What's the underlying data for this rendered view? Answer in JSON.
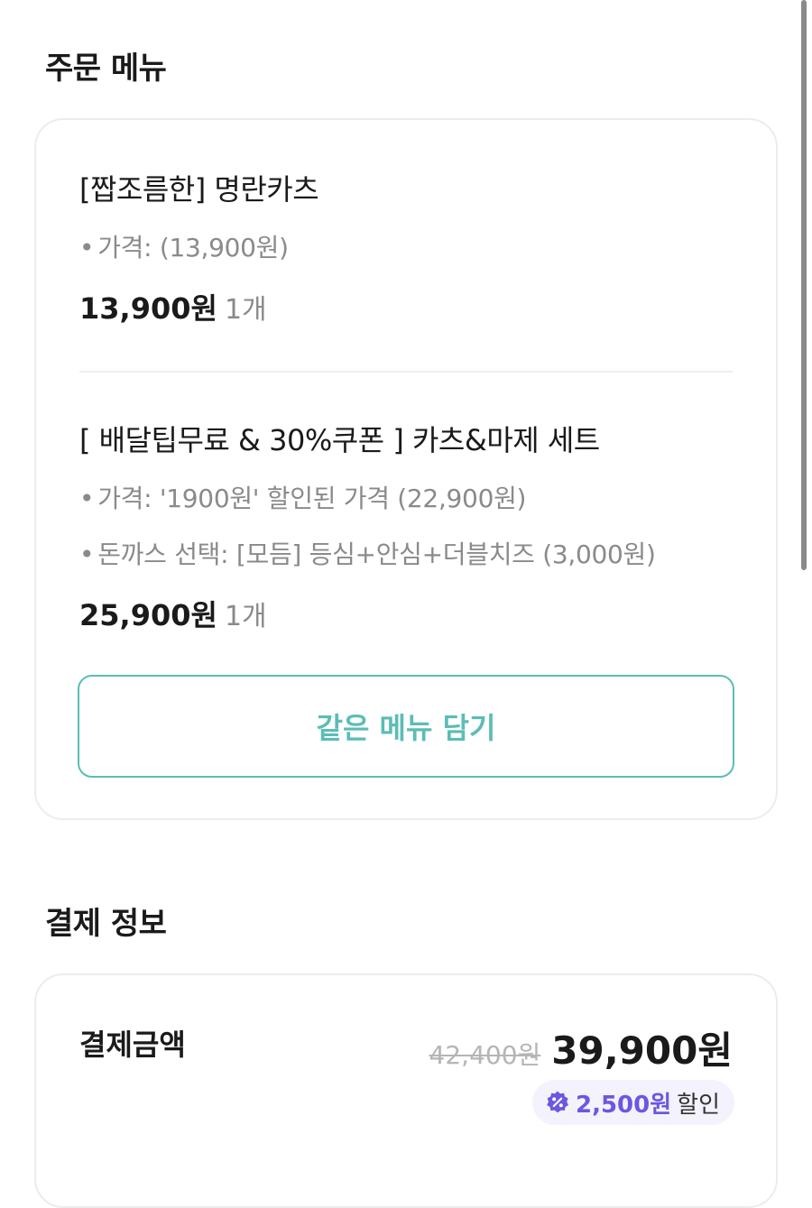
{
  "order_section": {
    "title": "주문 메뉴",
    "items": [
      {
        "name": "[짭조름한] 명란카츠",
        "options": [
          "가격: (13,900원)"
        ],
        "price": "13,900원",
        "quantity": "1개"
      },
      {
        "name": "[ 배달팁무료 & 30%쿠폰 ] 카츠&마제 세트",
        "options": [
          "가격: '1900원' 할인된 가격 (22,900원)",
          "돈까스 선택: [모듬] 등심+안심+더블치즈 (3,000원)"
        ],
        "price": "25,900원",
        "quantity": "1개"
      }
    ],
    "add_same_button": "같은 메뉴 담기"
  },
  "payment_section": {
    "title": "결제 정보",
    "label": "결제금액",
    "original_price": "42,400원",
    "final_price": "39,900원",
    "discount_amount": "2,500원",
    "discount_suffix": "할인"
  },
  "icons": {
    "discount": "discount-badge-icon",
    "bullet": "•"
  },
  "colors": {
    "accent_teal": "#5bbdb6",
    "discount_purple": "#6b57e0",
    "badge_bg": "#f3f2fd",
    "muted_text": "#8a8a8a"
  }
}
